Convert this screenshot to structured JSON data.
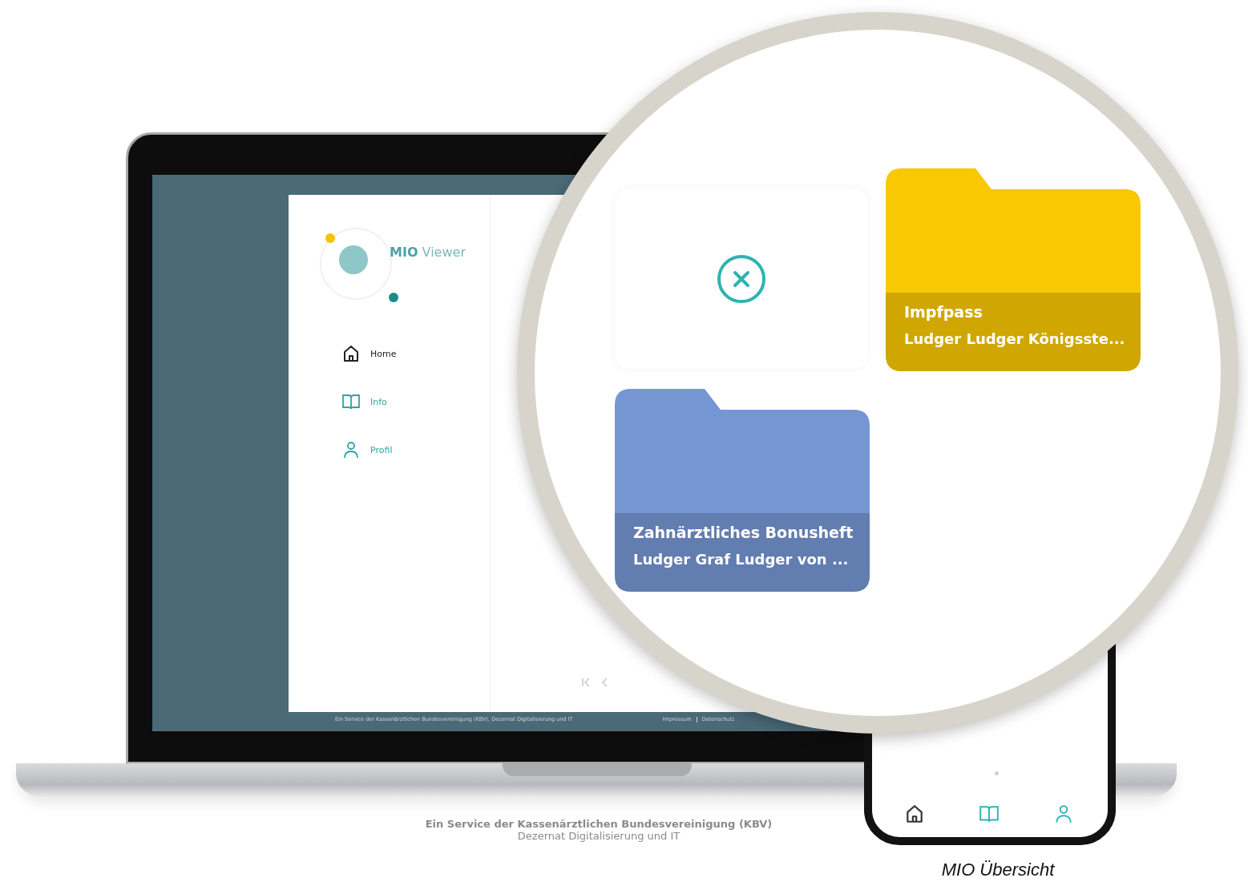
{
  "laptop": {
    "logo": {
      "brand": "MIO",
      "product": "Viewer"
    },
    "nav": [
      {
        "kind": "home",
        "label": "Home",
        "selected": true
      },
      {
        "kind": "info",
        "label": "Info",
        "selected": false
      },
      {
        "kind": "profile",
        "label": "Profil",
        "selected": false
      }
    ],
    "footer": {
      "text": "Ein Service der Kassenärztlichen Bundesvereinigung (KBV), Dezernat Digitalisierung und IT",
      "links": [
        "Impressum",
        "Datenschutz"
      ]
    }
  },
  "magnifier": {
    "folders": [
      {
        "title": "Impfpass",
        "subtitle": "Ludger Ludger Königsste...",
        "color": "#f8c803"
      },
      {
        "title": "Zahnärztliches Bonusheft",
        "subtitle": "Ludger Graf Ludger von ...",
        "color": "#7596d2"
      }
    ]
  },
  "phone": {
    "nav": [
      {
        "kind": "home",
        "selected": true
      },
      {
        "kind": "info",
        "selected": false
      },
      {
        "kind": "profile",
        "selected": false
      }
    ]
  },
  "credit": {
    "line1": "Ein Service der Kassenärztlichen Bundesvereinigung (KBV)",
    "line2": "Dezernat Digitalisierung und IT"
  },
  "caption": "MIO Übersicht"
}
